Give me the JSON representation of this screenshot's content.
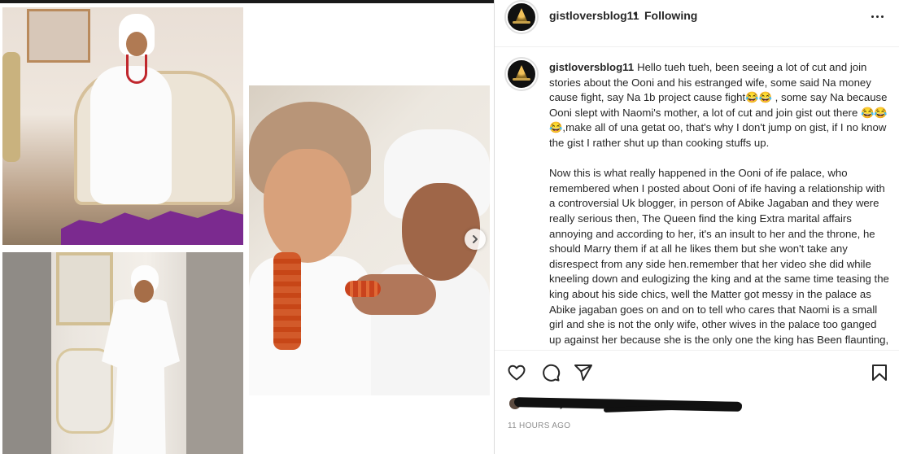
{
  "post": {
    "username": "gistloversblog11",
    "follow_separator": "•",
    "follow_status": "Following",
    "more_icon": "more-horizontal-icon",
    "caption_para1": "Hello tueh tueh, been seeing a lot of cut and join stories about the Ooni and his estranged wife, some said Na money cause fight, say Na 1b project cause fight😂😂 , some say Na because Ooni slept with Naomi's mother, a lot of cut and join gist out there 😂😂😂,make all of una getat oo, that's why I don't jump on gist, if I no know the gist I rather shut up than cooking stuffs up.",
    "caption_para2": "Now this is what really happened in the Ooni of ife palace, who remembered when I posted about Ooni of ife having a relationship with a controversial Uk blogger, in person of Abike Jagaban and they were really serious then, The Queen find the king Extra marital affairs annoying and according to her, it's an insult to her and the throne, he should Marry them if at all he likes them but she won't take any disrespect from any side hen.remember that her video she did while kneeling down and eulogizing the king and at the same time teasing the king about his side chics, well the Matter got messy in the palace as Abike jagaban goes on and on to tell who cares that Naomi is a small girl and she is not the only wife, other wives in the palace too ganged up against her because she is the only one the king has Been flaunting, she endured all of that until",
    "liked_by_text": "Liked by",
    "timestamp": "11 hours ago"
  },
  "actions": {
    "like_icon": "heart-icon",
    "comment_icon": "comment-icon",
    "share_icon": "paper-plane-icon",
    "save_icon": "bookmark-icon"
  },
  "carousel": {
    "next_icon": "chevron-right-icon"
  },
  "colors": {
    "text": "#262626",
    "muted": "#8e8e8e",
    "border": "#dbdbdb"
  }
}
